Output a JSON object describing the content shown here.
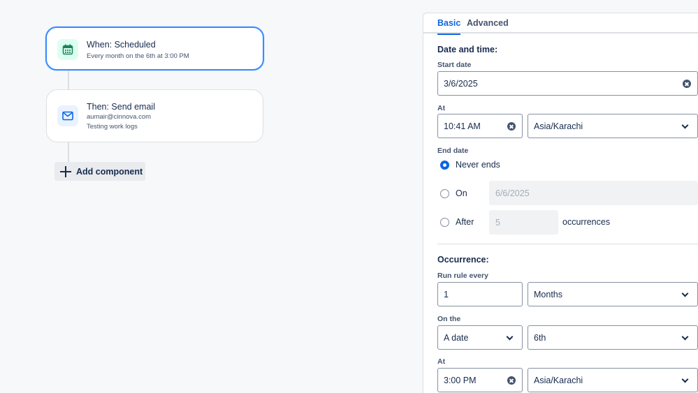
{
  "flow": {
    "trigger": {
      "title": "When: Scheduled",
      "subtitle": "Every month on the 6th at 3:00 PM",
      "icon": "calendar-icon",
      "icon_color": "#1f845a"
    },
    "action": {
      "title": "Then: Send email",
      "line1": "aumair@cinnova.com",
      "line2": "Testing work logs",
      "icon": "mail-icon",
      "icon_color": "#0c66e4"
    },
    "add_component_label": "Add component"
  },
  "panel": {
    "tabs": [
      {
        "label": "Basic",
        "active": true
      },
      {
        "label": "Advanced",
        "active": false
      }
    ],
    "date_time": {
      "heading": "Date and time:",
      "start_date_label": "Start date",
      "start_date_value": "3/6/2025",
      "at_label": "At",
      "time_value": "10:41 AM",
      "timezone_value": "Asia/Karachi",
      "end_date_label": "End date",
      "end_options": {
        "never_label": "Never ends",
        "on_label": "On",
        "on_date_value": "6/6/2025",
        "after_label": "After",
        "after_count_value": "5",
        "occurrences_label": "occurrences",
        "selected": "never"
      }
    },
    "occurrence": {
      "heading": "Occurrence:",
      "run_rule_label": "Run rule every",
      "interval_value": "1",
      "unit_value": "Months",
      "on_the_label": "On the",
      "on_type_value": "A date",
      "on_day_value": "6th",
      "at_label": "At",
      "time_value": "3:00 PM",
      "timezone_value": "Asia/Karachi"
    }
  },
  "colors": {
    "accent": "#0c66e4",
    "selected_border": "#388bff",
    "text": "#172b4d",
    "subtle_text": "#44546f"
  }
}
